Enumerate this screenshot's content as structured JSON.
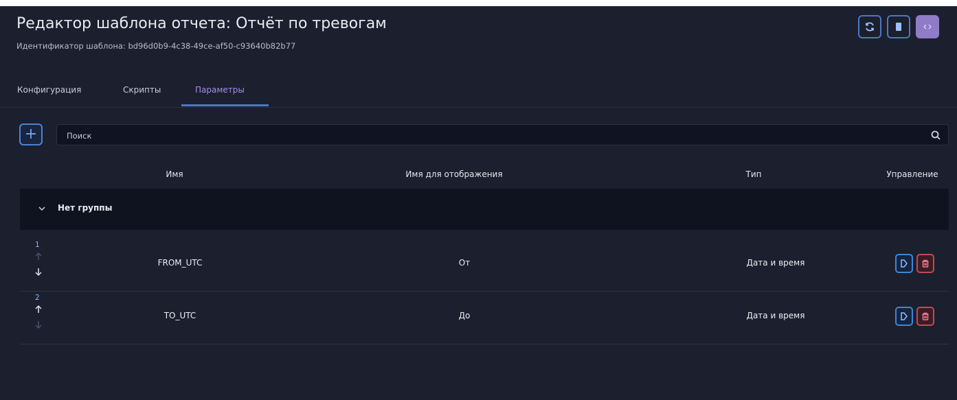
{
  "header": {
    "title": "Редактор шаблона отчета: Отчёт по тревогам",
    "subtitle": "Идентификатор шаблона:  bd96d0b9-4c38-49ce-af50-c93640b82b77",
    "buttons": [
      {
        "icon": "refresh-icon"
      },
      {
        "icon": "save-icon"
      },
      {
        "icon": "code-icon"
      }
    ]
  },
  "tabs": [
    {
      "label": "Конфигурация",
      "active": false
    },
    {
      "label": "Скрипты",
      "active": false
    },
    {
      "label": "Параметры",
      "active": true
    }
  ],
  "toolbar": {
    "add_label": "+",
    "search_placeholder": "Поиск",
    "search_value": ""
  },
  "table": {
    "columns": [
      "Имя",
      "Имя для отображения",
      "Тип",
      "Управление"
    ],
    "group": {
      "label": "Нет группы",
      "expanded": true
    },
    "rows": [
      {
        "index": "1",
        "name": "FROM_UTC",
        "display_name": "От",
        "type": "Дата и время",
        "can_move_up": false,
        "can_move_down": true
      },
      {
        "index": "2",
        "name": "TO_UTC",
        "display_name": "До",
        "type": "Дата и время",
        "can_move_up": true,
        "can_move_down": false
      }
    ]
  },
  "colors": {
    "background": "#1c1f2d",
    "panel_dark": "#0f1320",
    "accent_blue": "#4a84d6",
    "active_tab": "#a48cf0",
    "delete_red": "#c24a55",
    "code_button": "#8f7cc6"
  }
}
